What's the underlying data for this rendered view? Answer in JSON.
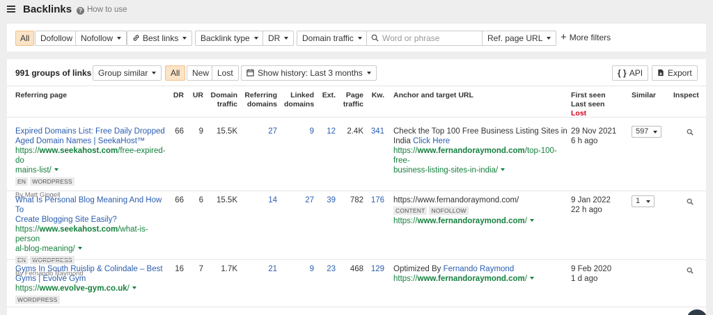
{
  "header": {
    "title": "Backlinks",
    "help_label": "How to use"
  },
  "filters": {
    "all": "All",
    "dofollow": "Dofollow",
    "nofollow": "Nofollow",
    "best_links": "Best links",
    "backlink_type": "Backlink type",
    "dr": "DR",
    "domain_traffic": "Domain traffic",
    "search_placeholder": "Word or phrase",
    "ref_page_url": "Ref. page URL",
    "more_filters": "More filters"
  },
  "toolbar": {
    "groups_count": "991 groups of links",
    "group_similar": "Group similar",
    "all": "All",
    "new": "New",
    "lost": "Lost",
    "show_history": "Show history: Last 3 months",
    "api": "API",
    "export": "Export"
  },
  "columns": {
    "referring_page": "Referring page",
    "dr": "DR",
    "ur": "UR",
    "domain_traffic": [
      "Domain",
      "traffic"
    ],
    "referring_domains": [
      "Referring",
      "domains"
    ],
    "linked_domains": [
      "Linked",
      "domains"
    ],
    "ext": "Ext.",
    "page_traffic": [
      "Page",
      "traffic"
    ],
    "kw": "Kw.",
    "anchor": "Anchor and target URL",
    "first_seen": "First seen",
    "last_seen": "Last seen",
    "lost": "Lost",
    "similar": "Similar",
    "inspect": "Inspect"
  },
  "rows": [
    {
      "title_l1": "Expired Domains List: Free Daily Dropped",
      "title_l2": "Aged Domain Names | SeekaHost™",
      "url_prefix": "https://",
      "url_domain": "www.seekahost.com",
      "url_path_l1": "/free-expired-do",
      "url_l2": "mains-list/",
      "tags": [
        "EN",
        "WORDPRESS"
      ],
      "author": "By Matt Gingell",
      "dr": "66",
      "ur": "9",
      "domain_traffic": "15.5K",
      "ref_domains": "27",
      "linked_domains": "9",
      "ext": "12",
      "page_traffic": "2.4K",
      "kw": "341",
      "anchor_l1": "Check the Top 100 Free Business Listing Sites in",
      "anchor_l2_text": "India ",
      "anchor_l2_link": "Click Here",
      "target_prefix": "https://",
      "target_domain": "www.fernandoraymond.com",
      "target_path_l1": "/top-100-free-",
      "target_l2": "business-listing-sites-in-india/",
      "first_seen": "29 Nov 2021",
      "last_seen": "6 h ago",
      "similar": "597"
    },
    {
      "title_l1": "What Is Personal Blog Meaning And How To",
      "title_l2": "Create Blogging Site Easily?",
      "url_prefix": "https://",
      "url_domain": "www.seekahost.com",
      "url_path_l1": "/what-is-person",
      "url_l2": "al-blog-meaning/",
      "tags": [
        "EN",
        "WORDPRESS"
      ],
      "author": "By Fernando Raymond",
      "dr": "66",
      "ur": "6",
      "domain_traffic": "15.5K",
      "ref_domains": "14",
      "linked_domains": "27",
      "ext": "39",
      "page_traffic": "782",
      "kw": "176",
      "anchor_l1": "https://www.fernandoraymond.com/",
      "anchor_tags": [
        "CONTENT",
        "NOFOLLOW"
      ],
      "target_prefix": "https://",
      "target_domain": "www.fernandoraymond.com",
      "target_path": "/",
      "first_seen": "9 Jan 2022",
      "last_seen": "22 h ago",
      "similar": "1"
    },
    {
      "title_l1": "Gyms In South Ruislip & Colindale – Best",
      "title_l2": "Gyms | Evolve Gym",
      "url_prefix": "https://",
      "url_domain": "www.evolve-gym.co.uk",
      "url_path": "/",
      "tags": [
        "WORDPRESS"
      ],
      "dr": "16",
      "ur": "7",
      "domain_traffic": "1.7K",
      "ref_domains": "21",
      "linked_domains": "9",
      "ext": "23",
      "page_traffic": "468",
      "kw": "129",
      "anchor_text": "Optimized By ",
      "anchor_link": "Fernando Raymond",
      "target_prefix": "https://",
      "target_domain": "www.fernandoraymond.com",
      "target_path": "/",
      "first_seen": "9 Feb 2020",
      "last_seen": "1 d ago"
    }
  ]
}
